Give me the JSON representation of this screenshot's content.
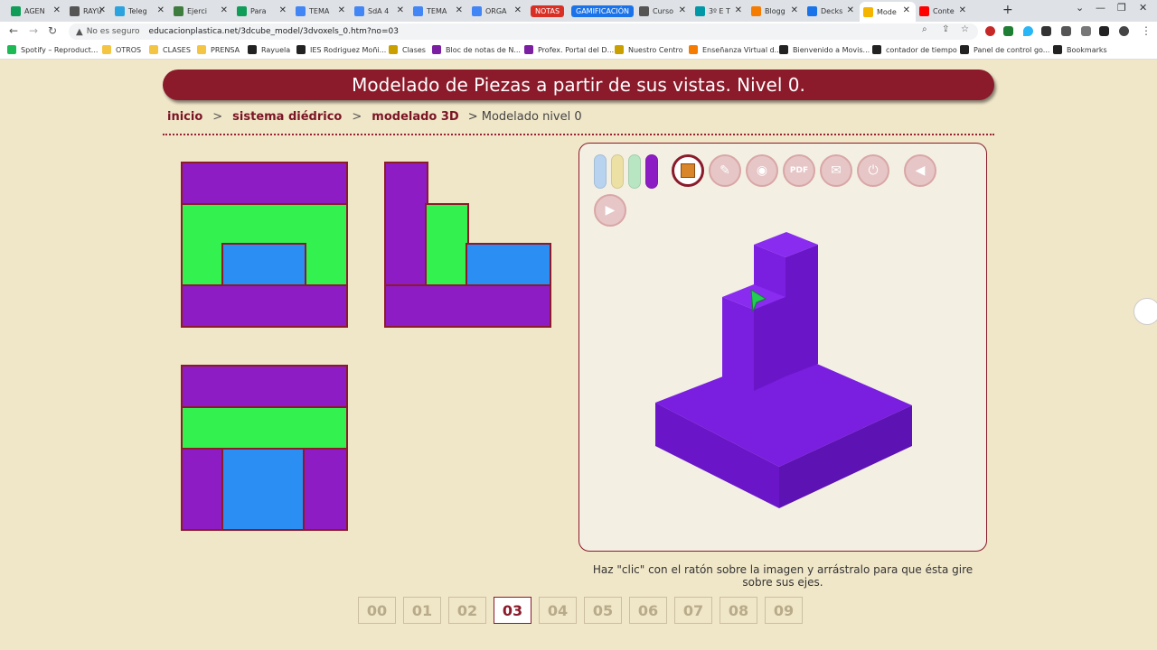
{
  "browser": {
    "tabs": [
      {
        "label": "AGEN",
        "color": "#0f9d58"
      },
      {
        "label": "RAYU",
        "color": "#555555"
      },
      {
        "label": "Teleg",
        "color": "#2aa3df"
      },
      {
        "label": "Ejerci",
        "color": "#3f7d3f"
      },
      {
        "label": "Para",
        "color": "#0f9d58"
      },
      {
        "label": "TEMA",
        "color": "#4285f4"
      },
      {
        "label": "SdA 4",
        "color": "#4285f4"
      },
      {
        "label": "TEMA",
        "color": "#4285f4"
      },
      {
        "label": "ORGA",
        "color": "#4285f4"
      },
      {
        "label": "NOTAS",
        "color": "#d93025",
        "pill": true
      },
      {
        "label": "GAMIFICACIÓN",
        "color": "#1a73e8",
        "pill": true
      },
      {
        "label": "Curso",
        "color": "#555555"
      },
      {
        "label": "3º E T",
        "color": "#0097a7"
      },
      {
        "label": "Blogg",
        "color": "#f57c00"
      },
      {
        "label": "Decks",
        "color": "#1a73e8"
      },
      {
        "label": "Mode",
        "color": "#f4b400",
        "active": true
      },
      {
        "label": "Conte",
        "color": "#ff0000"
      }
    ],
    "security_label": "No es seguro",
    "url": "educacionplastica.net/3dcube_model/3dvoxels_0.htm?no=03",
    "bookmarks": [
      "Spotify – Reproduct...",
      "OTROS",
      "CLASES",
      "PRENSA",
      "Rayuela",
      "IES Rodriguez Moñi...",
      "Clases",
      "Bloc de notas de N...",
      "Profex. Portal del D...",
      "Nuestro Centro",
      "Enseñanza Virtual d...",
      "Bienvenido a Movis...",
      "contador de tiempo",
      "Panel de control go...",
      "Bookmarks"
    ]
  },
  "page": {
    "title": "Modelado de Piezas a partir de sus vistas. Nivel 0.",
    "breadcrumb": {
      "home": "inicio",
      "sep": ">",
      "section": "sistema diédrico",
      "subsection": "modelado 3D",
      "current": "> Modelado nivel 0"
    },
    "hint": "Haz \"clic\" con el ratón sobre la imagen y arrástralo para que ésta gire sobre sus ejes.",
    "pager": [
      "00",
      "01",
      "02",
      "03",
      "04",
      "05",
      "06",
      "07",
      "08",
      "09"
    ],
    "current_page": "03",
    "colors": {
      "accent": "#8b1a2a",
      "view_purple": "#8e1cc4",
      "view_green": "#33f14f",
      "view_blue": "#2a8ef2",
      "model_purple": "#7a1ee0"
    },
    "swatches": [
      "#b7d3ef",
      "#ede0a5",
      "#b8e6c2",
      "#8e1cc4"
    ],
    "toolbar_icons": [
      "cube-icon",
      "eraser-icon",
      "camera-icon",
      "pdf-download-icon",
      "mail-icon",
      "power-icon",
      "back-icon",
      "play-icon"
    ],
    "pdf_label": "PDF"
  }
}
